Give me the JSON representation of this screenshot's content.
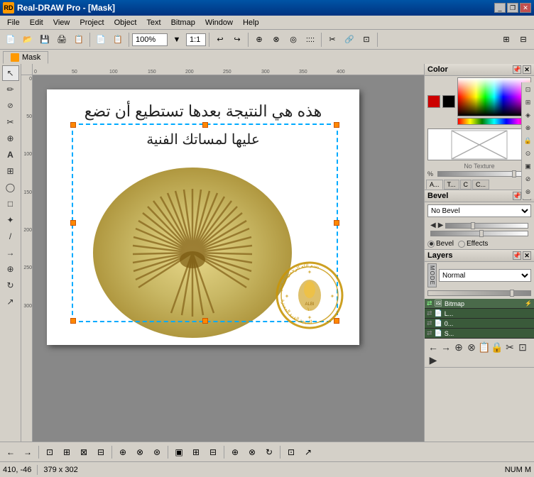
{
  "app": {
    "title": "Real-DRAW Pro - [Mask]",
    "icon_label": "RD"
  },
  "title_buttons": {
    "minimize": "_",
    "restore": "❐",
    "close": "✕"
  },
  "menu": {
    "items": [
      "File",
      "Edit",
      "View",
      "Project",
      "Object",
      "Text",
      "Bitmap",
      "Window",
      "Help"
    ]
  },
  "toolbar": {
    "zoom": "100%",
    "ratio": "1:1"
  },
  "tab": {
    "label": "Mask",
    "icon": ""
  },
  "canvas": {
    "arabic_top": "هذه هي النتيجة بعدها تستطيع أن تضع",
    "arabic_mid": "عليها لمساتك الفنية"
  },
  "ruler": {
    "h_ticks": [
      "0",
      "50",
      "100",
      "150",
      "200",
      "250",
      "300",
      "350",
      "400"
    ],
    "v_ticks": [
      "0",
      "50",
      "100",
      "150",
      "200",
      "250",
      "300"
    ]
  },
  "color_panel": {
    "title": "Color",
    "no_texture": "No Texture",
    "tabs": [
      "A...",
      "T...",
      "C",
      "C..."
    ]
  },
  "bevel_panel": {
    "title": "Bevel",
    "no_bevel": "No Bevel",
    "radio_bevel": "Bevel",
    "radio_effects": "Effects"
  },
  "layers_panel": {
    "title": "Layers",
    "mode": "Normal",
    "layer_items": [
      {
        "name": "Bitmap",
        "icon": "🖼"
      },
      {
        "name": "L...",
        "icon": "📄"
      },
      {
        "name": "0...",
        "icon": "📄"
      },
      {
        "name": "S...",
        "icon": "📄"
      }
    ]
  },
  "status_bar": {
    "coords": "410, -46",
    "size": "379 x 302",
    "mode": "NUM M"
  },
  "left_tools": [
    "↖",
    "✏",
    "⊘",
    "✂",
    "⊕",
    "T",
    "⊞",
    "◯",
    "□",
    "✦",
    "/",
    "⟵",
    "⊕",
    "⊙",
    "↗"
  ],
  "bottom_tools": [
    "←",
    "→",
    "⊡",
    "⊞",
    "⊠",
    "⊟",
    "⊕",
    "⊗",
    "⊛",
    "▣",
    "⊞",
    "⊟"
  ]
}
